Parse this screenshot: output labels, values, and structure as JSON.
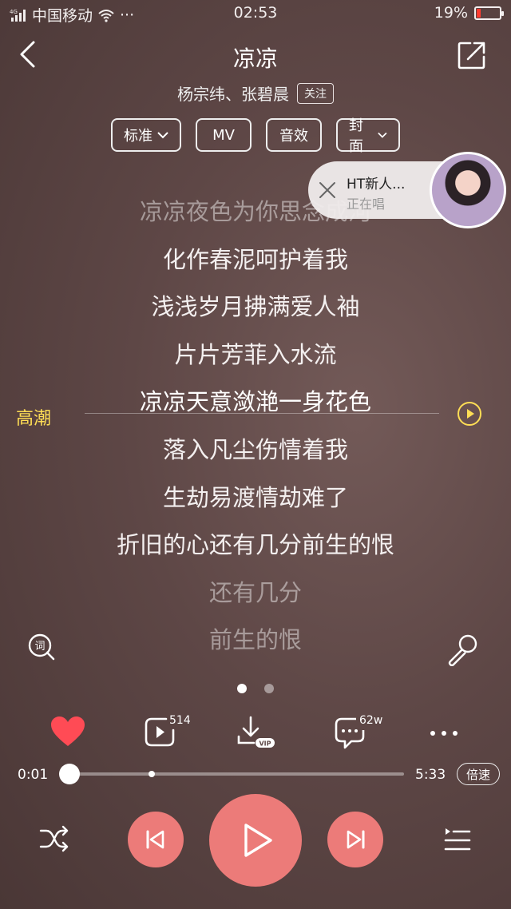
{
  "status": {
    "network": "4G",
    "carrier": "中国移动",
    "time": "02:53",
    "battery": "19%",
    "battery_level": 0.19,
    "more": "···"
  },
  "header": {
    "title": "凉凉",
    "artist": "杨宗纬、张碧晨",
    "follow": "关注"
  },
  "tabs": [
    "标准",
    "MV",
    "音效",
    "封面"
  ],
  "live": {
    "name": "HT新人...",
    "status": "正在唱"
  },
  "lyrics": [
    "凉凉夜色为你思念成河",
    "化作春泥呵护着我",
    "浅浅岁月拂满爱人袖",
    "片片芳菲入水流",
    "凉凉天意潋滟一身花色",
    "落入凡尘伤情着我",
    "生劫易渡情劫难了",
    "折旧的心还有几分前生的恨",
    "还有几分",
    "前生的恨"
  ],
  "climax_label": "高潮",
  "actions": {
    "play_count": "514",
    "comment_count": "62w",
    "download_badge": "VIP"
  },
  "progress": {
    "current": "0:01",
    "total": "5:33",
    "fraction": 0.02,
    "speed_label": "倍速"
  },
  "pager": {
    "count": 2,
    "active": 0
  },
  "colors": {
    "accent": "#ec7b79",
    "heart": "#ff4b55",
    "climax": "#ffde55"
  }
}
